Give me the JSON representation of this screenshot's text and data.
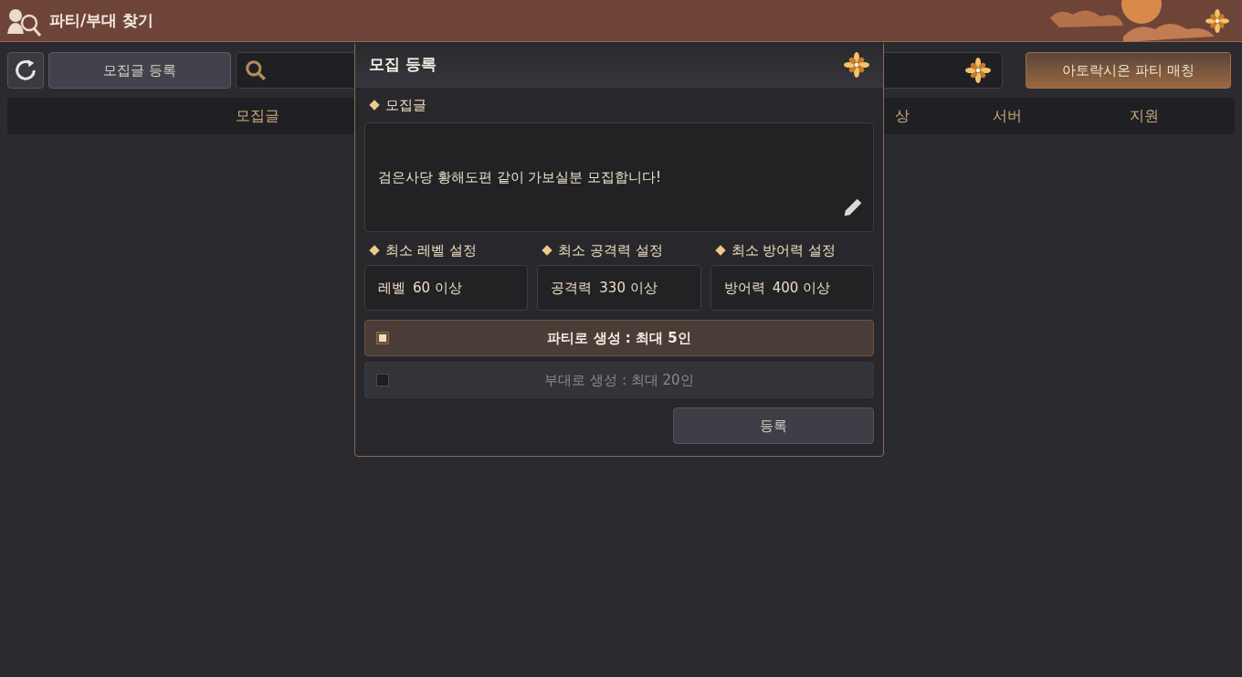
{
  "window": {
    "title": "파티/부대 찾기"
  },
  "toolbar": {
    "register_button": "모집글 등록",
    "match_button": "아토락시온 파티 매칭"
  },
  "table": {
    "columns": [
      {
        "label": "모집글"
      },
      {
        "label": "상"
      },
      {
        "label": "서버"
      },
      {
        "label": "지원"
      }
    ]
  },
  "dialog": {
    "title": "모집 등록",
    "post_label": "모집글",
    "post_text": "검은사당 황해도편 같이 가보실분 모집합니다!",
    "requirements": [
      {
        "label": "최소 레벨 설정",
        "name": "레벨",
        "value": "60 이상"
      },
      {
        "label": "최소 공격력 설정",
        "name": "공격력",
        "value": "330 이상"
      },
      {
        "label": "최소 방어력 설정",
        "name": "방어력",
        "value": "400 이상"
      }
    ],
    "options": [
      {
        "label": "파티로 생성 : 최대 5인",
        "selected": true
      },
      {
        "label": "부대로 생성 : 최대 20인",
        "selected": false
      }
    ],
    "submit_button": "등록"
  }
}
